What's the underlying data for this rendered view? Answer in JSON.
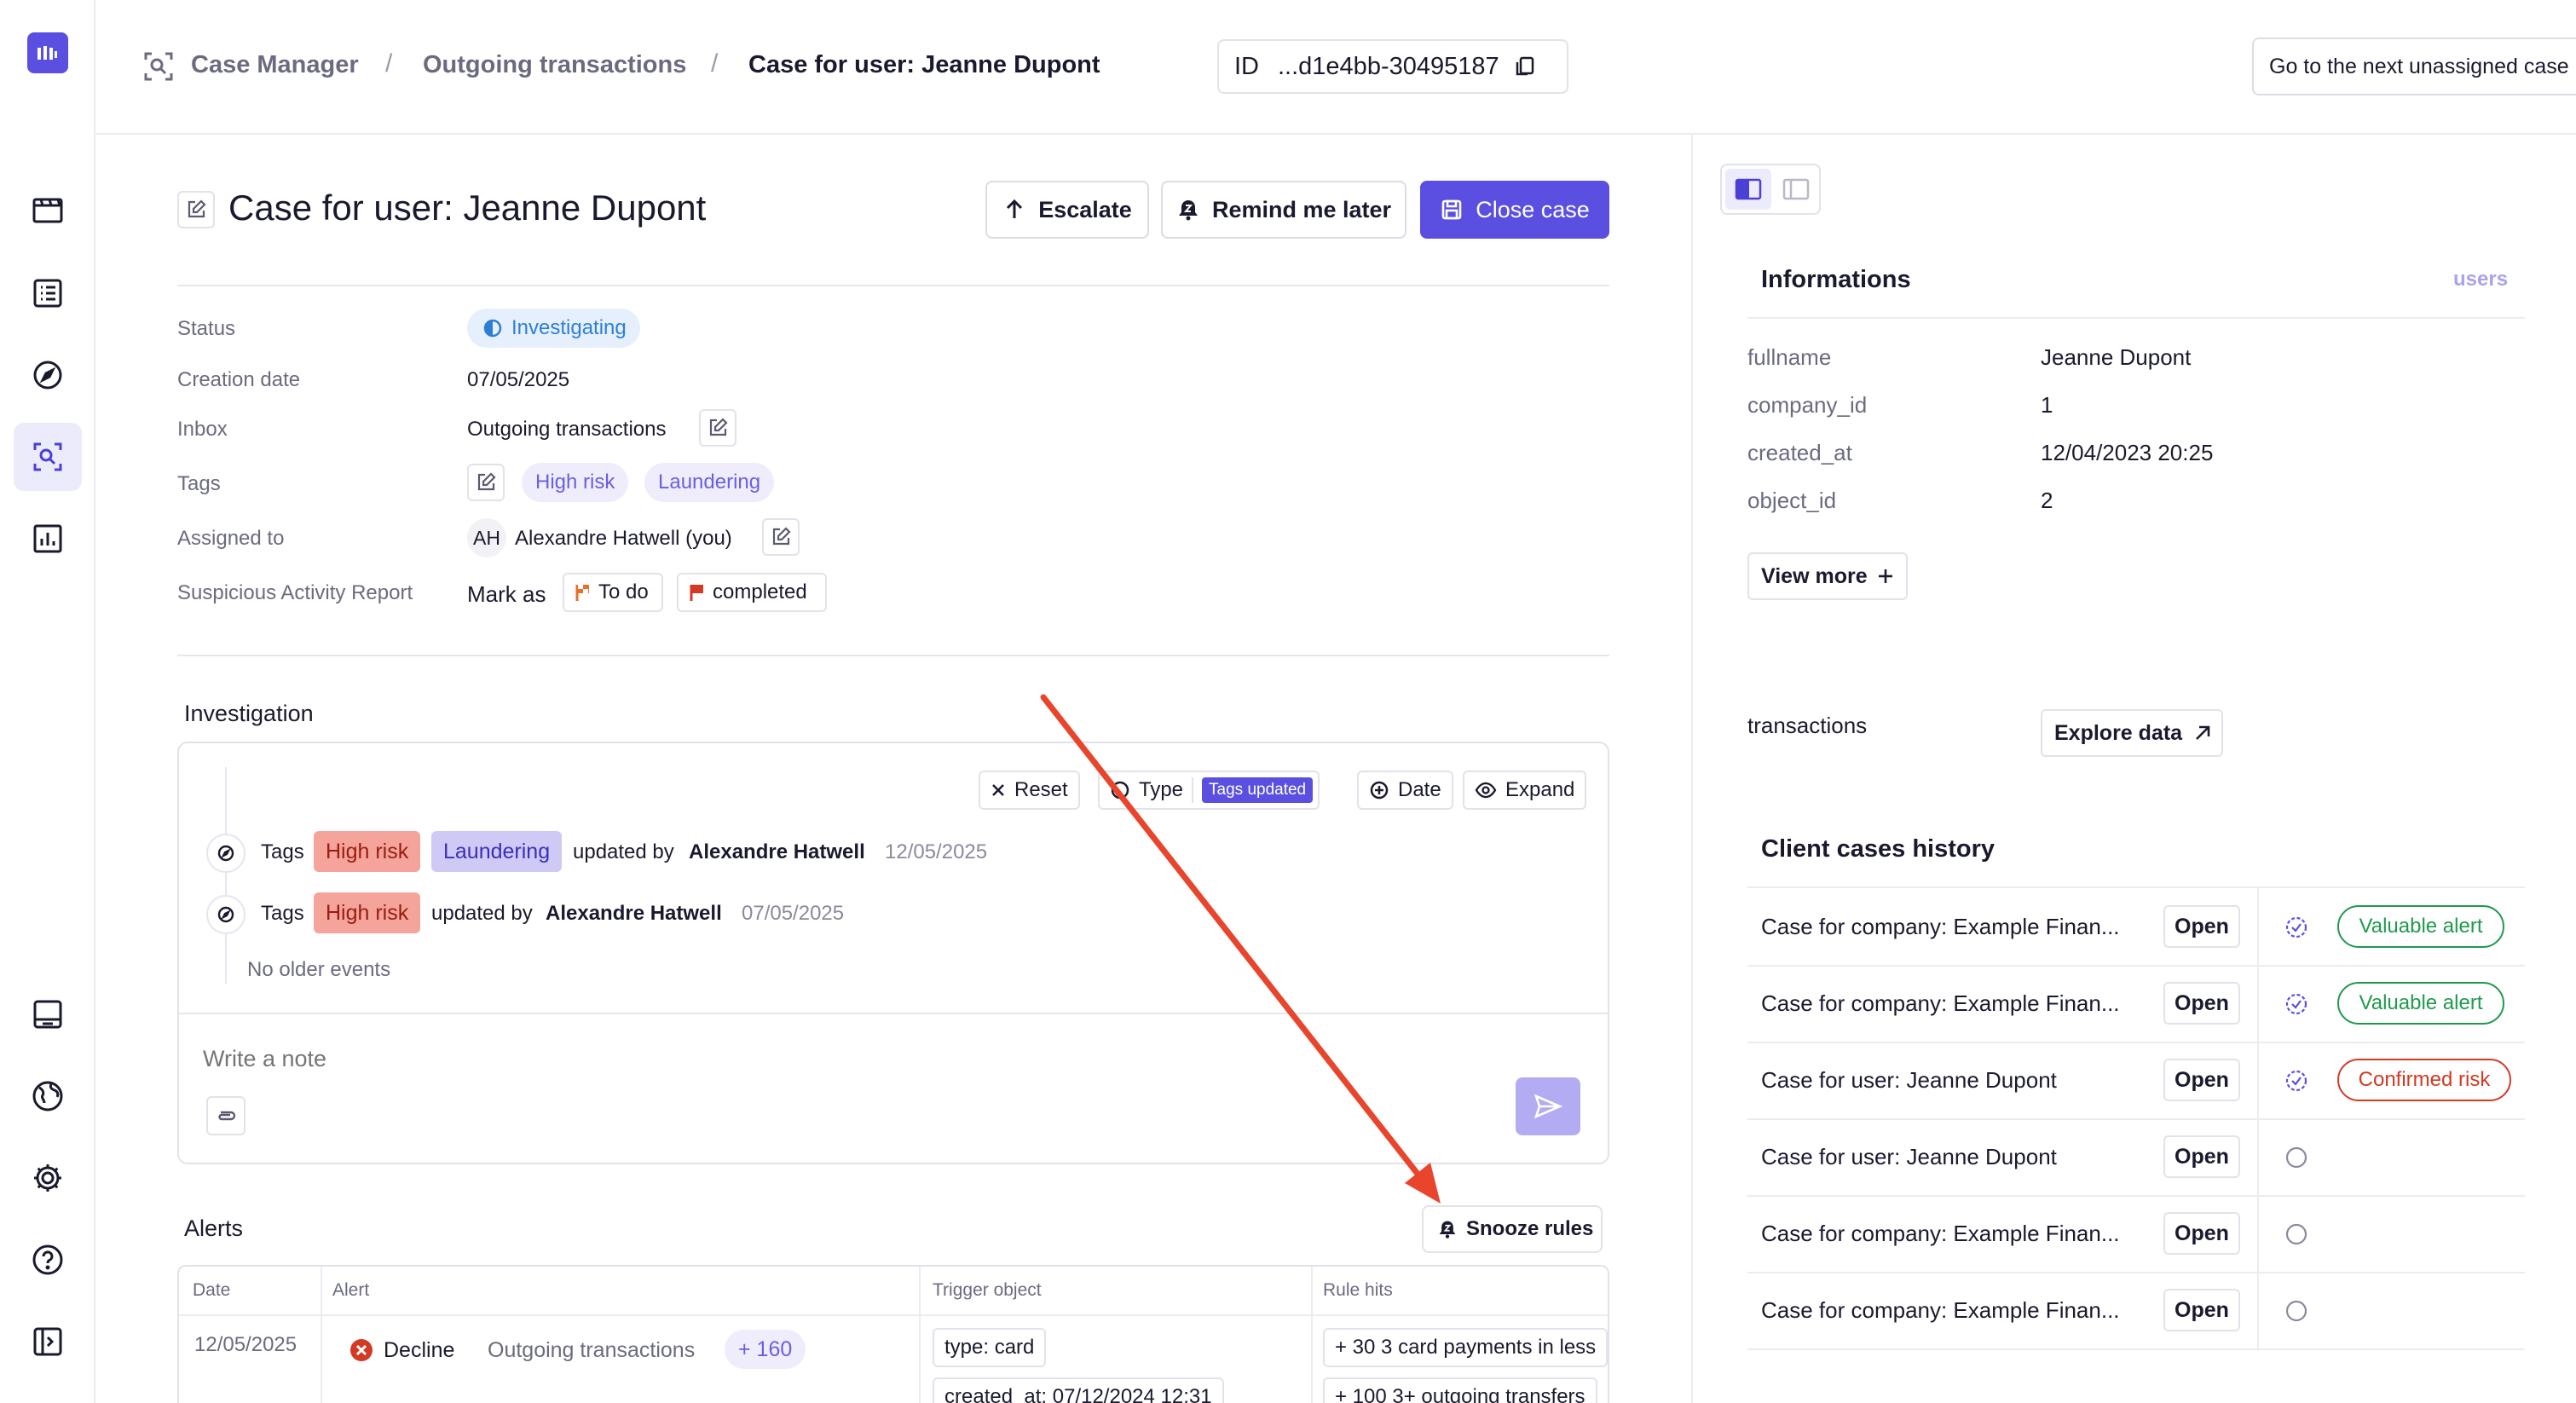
{
  "header": {
    "breadcrumb": [
      "Case Manager",
      "Outgoing transactions",
      "Case for user: Jeanne Dupont"
    ],
    "id_label": "ID",
    "id_value": "...d1e4bb-30495187",
    "next_case_label": "Go to the next unassigned case"
  },
  "sidebar": {
    "items": [
      {
        "icon": "film-icon"
      },
      {
        "icon": "list-icon"
      },
      {
        "icon": "compass-icon"
      },
      {
        "icon": "case-manager-icon",
        "active": true
      },
      {
        "icon": "analytics-icon"
      },
      {
        "icon": "panel-icon"
      },
      {
        "icon": "globe-icon"
      },
      {
        "icon": "settings-icon"
      },
      {
        "icon": "help-icon"
      },
      {
        "icon": "sidebar-toggle-icon"
      }
    ]
  },
  "case": {
    "title": "Case for user: Jeanne Dupont",
    "escalate_label": "Escalate",
    "remind_label": "Remind me later",
    "close_label": "Close case",
    "fields": {
      "status_label": "Status",
      "status_value": "Investigating",
      "creation_label": "Creation date",
      "creation_value": "07/05/2025",
      "inbox_label": "Inbox",
      "inbox_value": "Outgoing transactions",
      "tags_label": "Tags",
      "tags": [
        "High risk",
        "Laundering"
      ],
      "assigned_label": "Assigned to",
      "assigned_initials": "AH",
      "assigned_value": "Alexandre Hatwell (you)",
      "sar_label": "Suspicious Activity Report",
      "sar_mark_as": "Mark as",
      "sar_todo": "To do",
      "sar_completed": "completed"
    }
  },
  "investigation": {
    "title": "Investigation",
    "filters": {
      "reset": "Reset",
      "type": "Type",
      "type_badge": "Tags updated",
      "date": "Date",
      "expand": "Expand"
    },
    "events": [
      {
        "prefix": "Tags",
        "tags": [
          "High risk",
          "Laundering"
        ],
        "by": "updated by",
        "user": "Alexandre Hatwell",
        "date": "12/05/2025"
      },
      {
        "prefix": "Tags",
        "tags": [
          "High risk"
        ],
        "by": "updated by",
        "user": "Alexandre Hatwell",
        "date": "07/05/2025"
      }
    ],
    "no_older": "No older events",
    "note_placeholder": "Write a note"
  },
  "alerts": {
    "title": "Alerts",
    "snooze_label": "Snooze rules",
    "columns": [
      "Date",
      "Alert",
      "Trigger object",
      "Rule hits"
    ],
    "rows": [
      {
        "date": "12/05/2025",
        "outcome": "Decline",
        "inbox": "Outgoing transactions",
        "count": "+ 160",
        "trigger": [
          "type: card",
          "created_at: 07/12/2024 12:31"
        ],
        "rule_hits": [
          "+ 30 3 card payments in less",
          "+ 100 3+ outgoing transfers"
        ]
      }
    ]
  },
  "right_panel": {
    "informations_title": "Informations",
    "table_name": "users",
    "fields": [
      {
        "label": "fullname",
        "value": "Jeanne Dupont"
      },
      {
        "label": "company_id",
        "value": "1"
      },
      {
        "label": "created_at",
        "value": "12/04/2023 20:25"
      },
      {
        "label": "object_id",
        "value": "2"
      }
    ],
    "view_more": "View more",
    "transactions_label": "transactions",
    "explore_data": "Explore data",
    "history_title": "Client cases history",
    "history": [
      {
        "name": "Case for company: Example Finan...",
        "open": "Open",
        "status": "Valuable alert",
        "status_kind": "valuable",
        "reviewed": true
      },
      {
        "name": "Case for company: Example Finan...",
        "open": "Open",
        "status": "Valuable alert",
        "status_kind": "valuable",
        "reviewed": true
      },
      {
        "name": "Case for user: Jeanne Dupont",
        "open": "Open",
        "status": "Confirmed risk",
        "status_kind": "confirmed",
        "reviewed": true
      },
      {
        "name": "Case for user: Jeanne Dupont",
        "open": "Open",
        "status": "",
        "status_kind": "none",
        "reviewed": false
      },
      {
        "name": "Case for company: Example Finan...",
        "open": "Open",
        "status": "",
        "status_kind": "none",
        "reviewed": false
      },
      {
        "name": "Case for company: Example Finan...",
        "open": "Open",
        "status": "",
        "status_kind": "none",
        "reviewed": false
      }
    ]
  },
  "colors": {
    "accent": "#5a4fe0",
    "annotation_arrow": "#e8452c",
    "valuable": "#1f9a4d",
    "confirmed": "#d33a24"
  }
}
